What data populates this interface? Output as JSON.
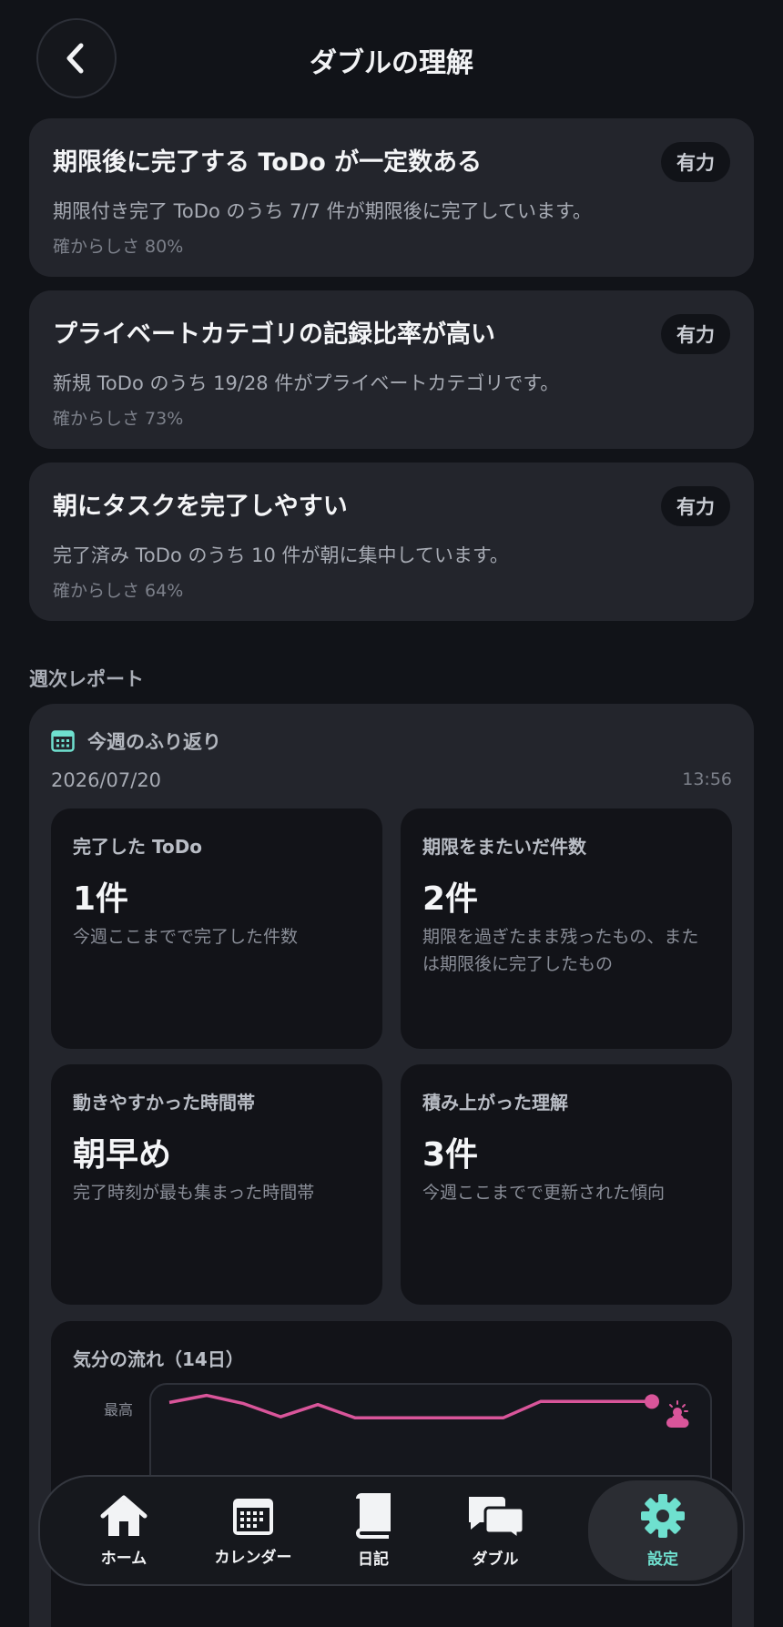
{
  "header": {
    "title": "ダブルの理解"
  },
  "insights": [
    {
      "title": "期限後に完了する ToDo が一定数ある",
      "badge": "有力",
      "description": "期限付き完了 ToDo のうち 7/7 件が期限後に完了しています。",
      "confidence": "確からしさ 80%"
    },
    {
      "title": "プライベートカテゴリの記録比率が高い",
      "badge": "有力",
      "description": "新規 ToDo のうち 19/28 件がプライベートカテゴリです。",
      "confidence": "確からしさ 73%"
    },
    {
      "title": "朝にタスクを完了しやすい",
      "badge": "有力",
      "description": "完了済み ToDo のうち 10 件が朝に集中しています。",
      "confidence": "確からしさ 64%"
    }
  ],
  "weekly": {
    "section_label": "週次レポート",
    "card_title": "今週のふり返り",
    "date": "2026/07/20",
    "time": "13:56",
    "stats": [
      {
        "label": "完了した ToDo",
        "value": "1件",
        "note": "今週ここまでで完了した件数"
      },
      {
        "label": "期限をまたいだ件数",
        "value": "2件",
        "note": "期限を過ぎたまま残ったもの、または期限後に完了したもの"
      },
      {
        "label": "動きやすかった時間帯",
        "value": "朝早め",
        "note": "完了時刻が最も集まった時間帯"
      },
      {
        "label": "積み上がった理解",
        "value": "3件",
        "note": "今週ここまでで更新された傾向"
      }
    ],
    "mood": {
      "title": "気分の流れ（14日）",
      "axis_top": "最高",
      "values": [
        0.88,
        0.95,
        0.87,
        0.74,
        0.86,
        0.73,
        0.73,
        0.73,
        0.73,
        0.73,
        0.89,
        0.89,
        0.89,
        0.89
      ],
      "line_color": "#D9559A",
      "end_icon": "sun-cloud-icon"
    }
  },
  "nav": {
    "items": [
      {
        "label": "ホーム",
        "icon": "home-icon"
      },
      {
        "label": "カレンダー",
        "icon": "calendar-icon"
      },
      {
        "label": "日記",
        "icon": "book-icon"
      },
      {
        "label": "ダブル",
        "icon": "chat-bubbles-icon"
      },
      {
        "label": "設定",
        "icon": "gear-icon",
        "active": true
      }
    ],
    "accent_color": "#6FE0CF"
  }
}
